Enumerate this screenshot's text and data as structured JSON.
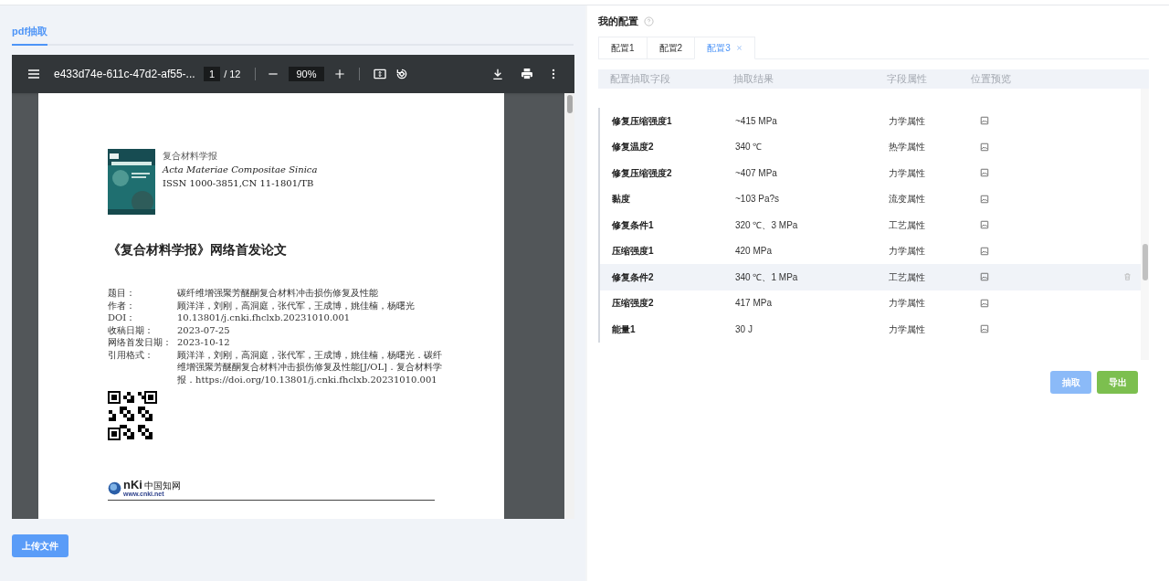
{
  "left_tabs": [
    {
      "label": "pdf抽取",
      "selected": true
    }
  ],
  "pdf_viewer": {
    "file_name": "e433d74e-611c-47d2-af55-...",
    "page": "1",
    "page_total": "/ 12",
    "zoom": "90%",
    "page_content": {
      "journal_cn": "复合材料学报",
      "journal_en": "Acta Materiae Compositae Sinica",
      "issn": "ISSN 1000-3851,CN 11-1801/TB",
      "title": "《复合材料学报》网络首发论文",
      "meta": [
        {
          "label": "题目：",
          "value": "碳纤维增强聚芳醚酮复合材料冲击损伤修复及性能"
        },
        {
          "label": "作者：",
          "value": "顾洋洋，刘刚，高洞庭，张代军，王成博，姚佳楠，杨曙光"
        },
        {
          "label": "DOI：",
          "value": "10.13801/j.cnki.fhclxb.20231010.001"
        },
        {
          "label": "收稿日期：",
          "value": "2023-07-25"
        },
        {
          "label": "网络首发日期：",
          "value": "2023-10-12"
        },
        {
          "label": "引用格式：",
          "value": "顾洋洋，刘刚，高洞庭，张代军，王成博，姚佳楠，杨曙光．碳纤维增强聚芳醚酮复合材料冲击损伤修复及性能[J/OL]．复合材料学报．https://doi.org/10.13801/j.cnki.fhclxb.20231010.001"
        }
      ],
      "logo": {
        "mark": "nKi",
        "name": "中国知网",
        "url": "www.cnki.net"
      }
    }
  },
  "upload_button": "上传文件",
  "config": {
    "title": "我的配置",
    "tabs": [
      {
        "label": "配置1",
        "selected": false
      },
      {
        "label": "配置2",
        "selected": false
      },
      {
        "label": "配置3",
        "selected": true
      }
    ],
    "columns": [
      "配置抽取字段",
      "抽取结果",
      "字段属性",
      "位置预览"
    ],
    "rows": [
      {
        "field": "修复压缩强度1",
        "result": "~415 MPa",
        "attribute": "力学属性",
        "highlighted": false
      },
      {
        "field": "修复温度2",
        "result": "340 ℃",
        "attribute": "热学属性",
        "highlighted": false
      },
      {
        "field": "修复压缩强度2",
        "result": "~407 MPa",
        "attribute": "力学属性",
        "highlighted": false
      },
      {
        "field": "黏度",
        "result": "~103 Pa?s",
        "attribute": "流变属性",
        "highlighted": false
      },
      {
        "field": "修复条件1",
        "result": "320 ℃、3 MPa",
        "attribute": "工艺属性",
        "highlighted": false
      },
      {
        "field": "压缩强度1",
        "result": "420 MPa",
        "attribute": "力学属性",
        "highlighted": false
      },
      {
        "field": "修复条件2",
        "result": "340 ℃、1 MPa",
        "attribute": "工艺属性",
        "highlighted": true
      },
      {
        "field": "压缩强度2",
        "result": "417 MPa",
        "attribute": "力学属性",
        "highlighted": false
      },
      {
        "field": "能量1",
        "result": "30 J",
        "attribute": "力学属性",
        "highlighted": false
      }
    ],
    "buttons": [
      {
        "label": "抽取",
        "kind": "primary"
      },
      {
        "label": "导出",
        "kind": "success"
      }
    ]
  }
}
